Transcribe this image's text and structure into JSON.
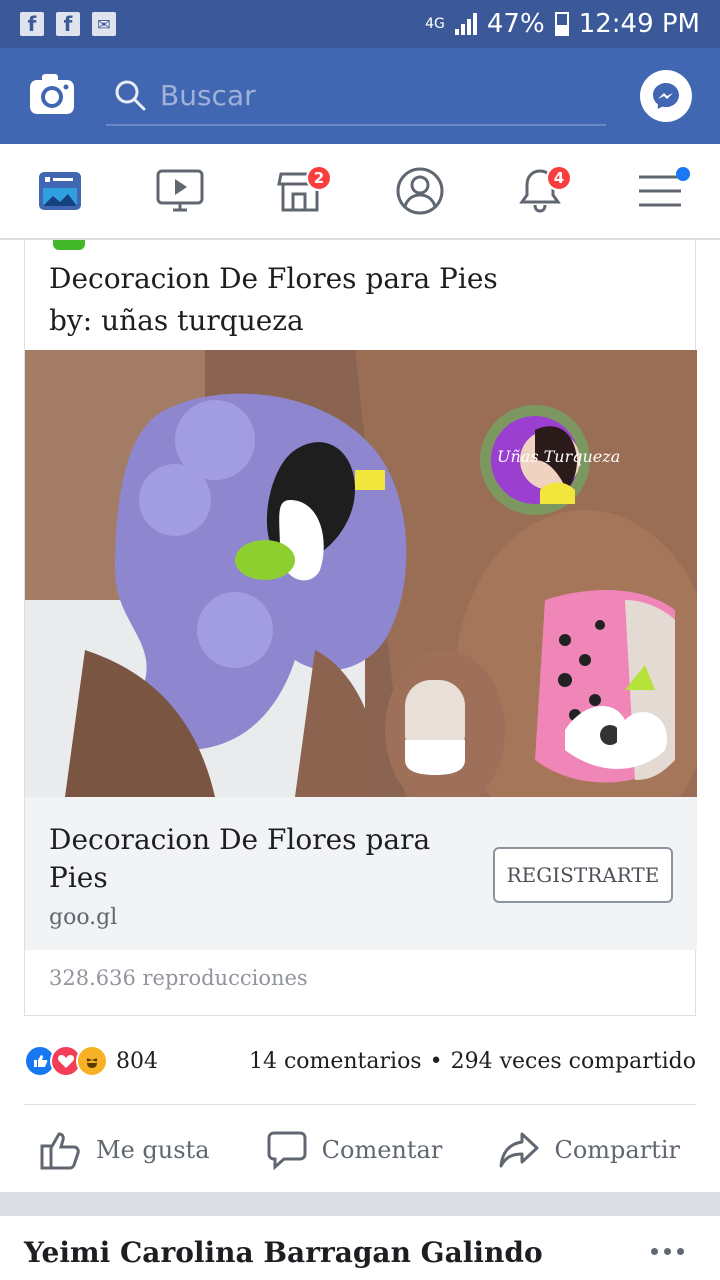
{
  "status_bar": {
    "network": "4G",
    "battery": "47%",
    "time": "12:49 PM"
  },
  "search": {
    "placeholder": "Buscar"
  },
  "nav": {
    "marketplace_badge": "2",
    "notifications_badge": "4"
  },
  "post": {
    "title_line1": "Decoracion De Flores para Pies",
    "title_line2": "by: uñas turqueza",
    "link_title": "Decoracion De Flores para Pies",
    "link_domain": "goo.gl",
    "cta_label": "REGISTRARTE",
    "views": "328.636 reproducciones",
    "video_logo_text": "Uñas Turqueza"
  },
  "reactions": {
    "count": "804",
    "comments": "14 comentarios",
    "separator": "•",
    "shares": "294 veces compartido"
  },
  "actions": {
    "like": "Me gusta",
    "comment": "Comentar",
    "share": "Compartir"
  },
  "next_post": {
    "author": "Yeimi Carolina Barragan Galindo"
  },
  "colors": {
    "facebook_blue": "#3b5998",
    "header_blue": "#4267b2",
    "badge_red": "#fa3e3e"
  }
}
